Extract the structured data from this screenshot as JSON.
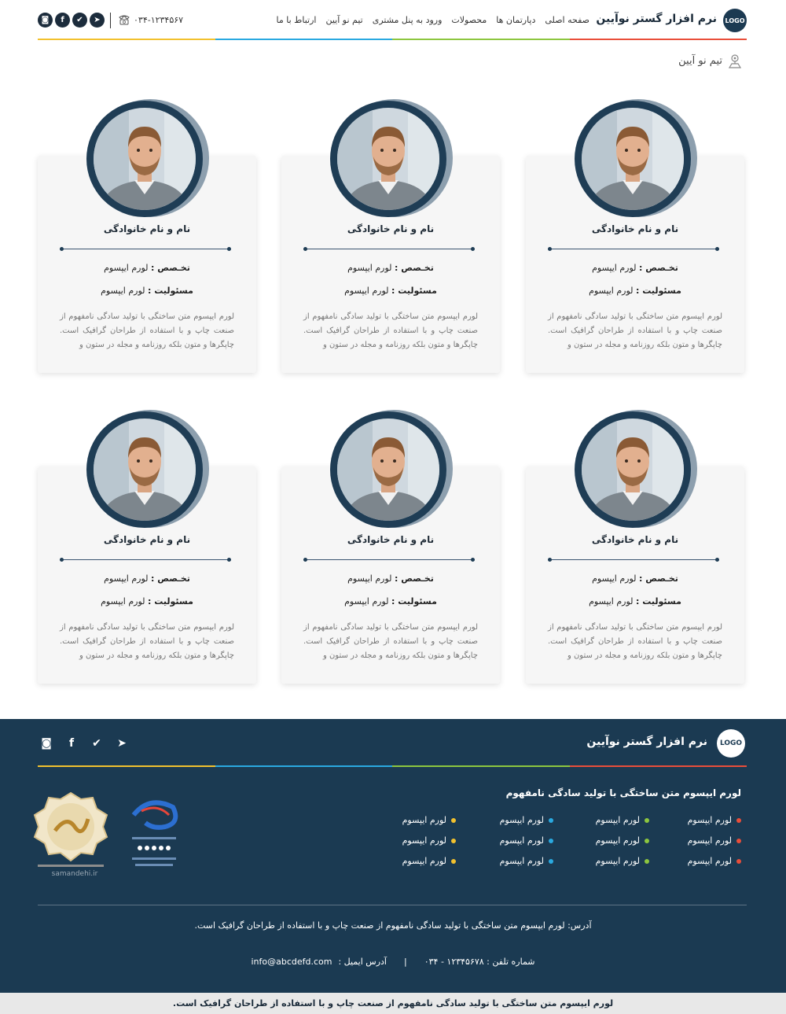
{
  "header": {
    "logo_text": "LOGO",
    "brand": "نرم افزار گستر نوآیین",
    "nav": [
      "صفحه اصلی",
      "دپارتمان ها",
      "محصولات",
      "ورود به پنل مشتری",
      "تیم نو آیین",
      "ارتباط با ما"
    ],
    "phone": "۰۳۴-۱۲۳۴۵۶۷",
    "socials": [
      "telegram-icon",
      "twitter-icon",
      "facebook-icon",
      "instagram-icon"
    ],
    "rainbow": [
      "#e94e3a",
      "#8dc63f",
      "#2aa9e0",
      "#f2c12e"
    ]
  },
  "breadcrumb": {
    "label": "تیم نو آیین"
  },
  "team": [
    {
      "name": "نام و نام خانوادگی",
      "specialty_label": "تخـصص :",
      "specialty_value": "لورم ایپسوم",
      "role_label": "مسئولیت :",
      "role_value": "لورم ایپسوم",
      "desc": "لورم ایپسوم متن ساختگی با تولید سادگی نامفهوم از صنعت چاپ و با استفاده از طراحان گرافیک است. چاپگرها و متون بلکه روزنامه و مجله در ستون و"
    },
    {
      "name": "نام و نام خانوادگی",
      "specialty_label": "تخـصص :",
      "specialty_value": "لورم ایپسوم",
      "role_label": "مسئولیت :",
      "role_value": "لورم ایپسوم",
      "desc": "لورم ایپسوم متن ساختگی با تولید سادگی نامفهوم از صنعت چاپ و با استفاده از طراحان گرافیک است. چاپگرها و متون بلکه روزنامه و مجله در ستون و"
    },
    {
      "name": "نام و نام خانوادگی",
      "specialty_label": "تخـصص :",
      "specialty_value": "لورم ایپسوم",
      "role_label": "مسئولیت :",
      "role_value": "لورم ایپسوم",
      "desc": "لورم ایپسوم متن ساختگی با تولید سادگی نامفهوم از صنعت چاپ و با استفاده از طراحان گرافیک است. چاپگرها و متون بلکه روزنامه و مجله در ستون و"
    },
    {
      "name": "نام و نام خانوادگی",
      "specialty_label": "تخـصص :",
      "specialty_value": "لورم ایپسوم",
      "role_label": "مسئولیت :",
      "role_value": "لورم ایپسوم",
      "desc": "لورم ایپسوم متن ساختگی با تولید سادگی نامفهوم از صنعت چاپ و با استفاده از طراحان گرافیک است. چاپگرها و متون بلکه روزنامه و مجله در ستون و"
    },
    {
      "name": "نام و نام خانوادگی",
      "specialty_label": "تخـصص :",
      "specialty_value": "لورم ایپسوم",
      "role_label": "مسئولیت :",
      "role_value": "لورم ایپسوم",
      "desc": "لورم ایپسوم متن ساختگی با تولید سادگی نامفهوم از صنعت چاپ و با استفاده از طراحان گرافیک است. چاپگرها و متون بلکه روزنامه و مجله در ستون و"
    },
    {
      "name": "نام و نام خانوادگی",
      "specialty_label": "تخـصص :",
      "specialty_value": "لورم ایپسوم",
      "role_label": "مسئولیت :",
      "role_value": "لورم ایپسوم",
      "desc": "لورم ایپسوم متن ساختگی با تولید سادگی نامفهوم از صنعت چاپ و با استفاده از طراحان گرافیک است. چاپگرها و متون بلکه روزنامه و مجله در ستون و"
    }
  ],
  "footer": {
    "logo_text": "LOGO",
    "brand": "نرم افزار گستر نوآیین",
    "socials": [
      "telegram-icon",
      "twitter-icon",
      "facebook-icon",
      "instagram-icon"
    ],
    "heading": "لورم ایپسوم متن ساختگی با تولید سادگی نامفهوم",
    "link_columns": [
      {
        "color": "#e94e3a",
        "items": [
          "لورم ایپسوم",
          "لورم ایپسوم",
          "لورم ایپسوم"
        ]
      },
      {
        "color": "#8dc63f",
        "items": [
          "لورم ایپسوم",
          "لورم ایپسوم",
          "لورم ایپسوم"
        ]
      },
      {
        "color": "#2aa9e0",
        "items": [
          "لورم ایپسوم",
          "لورم ایپسوم",
          "لورم ایپسوم"
        ]
      },
      {
        "color": "#f2c12e",
        "items": [
          "لورم ایپسوم",
          "لورم ایپسوم",
          "لورم ایپسوم"
        ]
      }
    ],
    "badge_samandehi": "samandehi.ir",
    "address": "آدرس: لورم ایپسوم متن ساختگی با تولید سادگی نامفهوم از صنعت چاپ و با استفاده از طراحان گرافیک است.",
    "phone": "شماره تلفن : ۱۲۳۴۵۶۷۸ - ۰۳۴",
    "separator": "|",
    "email_label": "آدرس ایمیل :",
    "email": "info@abcdefd.com",
    "copyright": "لورم ایپسوم متن ساختگی با تولید سادگی نامفهوم از صنعت چاپ و با استفاده از طراحان گرافیک است."
  }
}
